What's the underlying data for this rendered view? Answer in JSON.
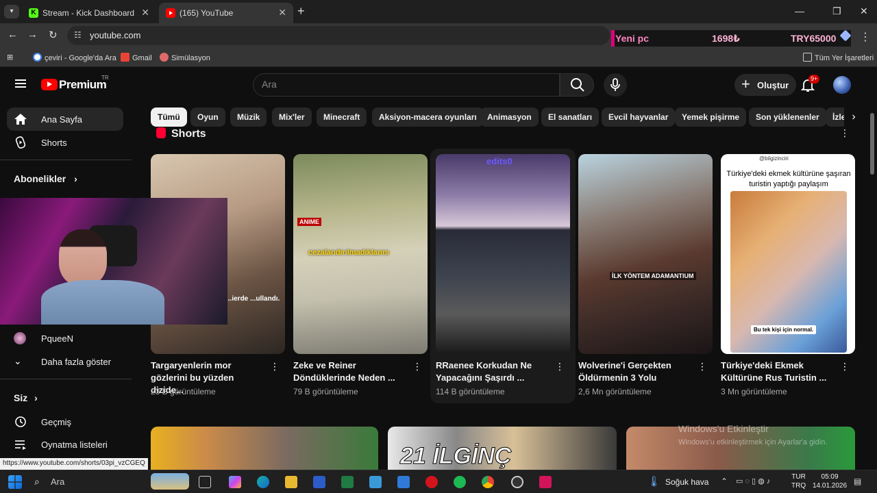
{
  "browser": {
    "tabs": [
      {
        "title": "Stream - Kick Dashboard",
        "favicon": "kick-icon"
      },
      {
        "title": "(165) YouTube",
        "favicon": "youtube-icon"
      }
    ],
    "address": "youtube.com",
    "ticker": {
      "label": "Yeni pc",
      "amount": "1698₺",
      "goal": "TRY65000"
    },
    "bookmarks": [
      {
        "label": "çeviri - Google'da Ara"
      },
      {
        "label": "Gmail"
      },
      {
        "label": "Simülasyon"
      }
    ],
    "all_bookmarks": "Tüm Yer İşaretleri",
    "hover_url": "https://www.youtube.com/shorts/03pi_vzCGEQ"
  },
  "masthead": {
    "logo_text": "Premium",
    "region": "TR",
    "search_placeholder": "Ara",
    "create_label": "Oluştur",
    "notification_count": "9+"
  },
  "sidebar": {
    "items": [
      {
        "label": "Ana Sayfa",
        "icon": "home-icon"
      },
      {
        "label": "Shorts",
        "icon": "shorts-icon"
      }
    ],
    "subscriptions_title": "Abonelikler",
    "subscriptions": [
      {
        "label": "PqueeN"
      }
    ],
    "show_more": "Daha fazla göster",
    "you_title": "Siz",
    "you_items": [
      {
        "label": "Geçmiş",
        "icon": "history-icon"
      },
      {
        "label": "Oynatma listeleri",
        "icon": "playlist-icon"
      }
    ]
  },
  "chips": [
    "Tümü",
    "Oyun",
    "Müzik",
    "Mix'ler",
    "Minecraft",
    "Aksiyon-macera oyunları",
    "Animasyon",
    "El sanatları",
    "Evcil hayvanlar",
    "Yemek pişirme",
    "Son yüklenenler",
    "İzle"
  ],
  "shorts": {
    "title": "Shorts",
    "items": [
      {
        "title": "Targaryenlerin mor gözlerini bu yüzden dizide...",
        "views": "23 B görüntüleme",
        "overlay": "...ierde ...ullandı."
      },
      {
        "title": "Zeke ve Reiner Döndüklerinde Neden ...",
        "views": "79 B görüntüleme",
        "overlay": "cezalandırılmadıklarını",
        "badge": "ANIME"
      },
      {
        "title": "RRaenee Korkudan Ne Yapacağını Şaşırdı ...",
        "views": "114 B görüntüleme",
        "overlay": "edits0"
      },
      {
        "title": "Wolverine'i Gerçekten Öldürmenin 3 Yolu",
        "views": "2,6 Mn görüntüleme",
        "overlay": "İLK YÖNTEM ADAMANTIUM"
      },
      {
        "title": "Türkiye'deki Ekmek Kültürüne Rus Turistin ...",
        "views": "3 Mn görüntüleme",
        "overlay_handle": "@bilgizinciri",
        "overlay_head": "Türkiye'deki ekmek kültürüne şaşıran turistin yaptığı paylaşım",
        "overlay_caption": "Bu tek kişi için normal."
      }
    ]
  },
  "bottom_row_text": "21 İLGİNÇ",
  "windows_watermark": {
    "title": "Windows'u Etkinleştir",
    "subtitle": "Windows'u etkinleştirmek için Ayarlar'a gidin."
  },
  "taskbar": {
    "search": "Ara",
    "weather": "Soğuk hava",
    "lang_top": "TUR",
    "lang_bottom": "TRQ",
    "time": "05:09",
    "date": "14.01.2026"
  }
}
